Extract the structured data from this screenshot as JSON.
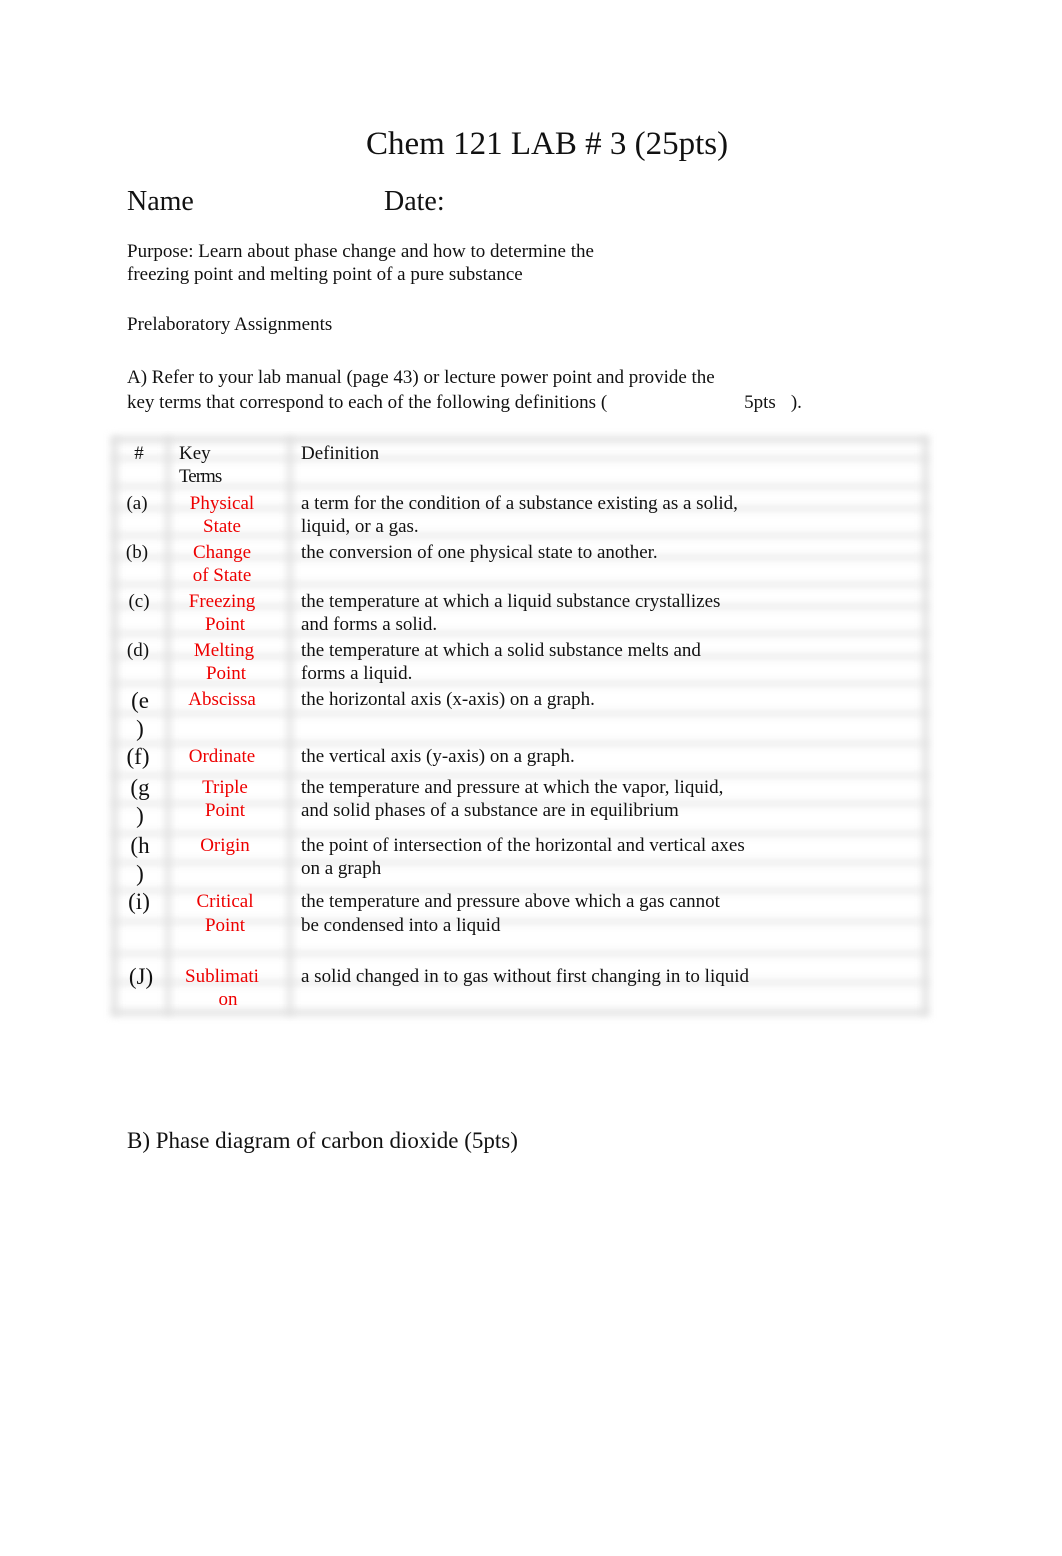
{
  "document": {
    "title": "Chem 121 LAB # 3 (25pts)",
    "name_label": "Name",
    "date_label": "Date:",
    "purpose_line1": "Purpose: Learn about phase change and how to determine the",
    "purpose_line2": "freezing point and melting point of a pure substance",
    "prelab_heading": "Prelaboratory Assignments",
    "instruction_line1": "A)  Refer to your lab manual (page 43) or lecture power point and provide the",
    "instruction_line2_start": "key terms that correspond to each of the following definitions (",
    "instruction_points": "5pts",
    "instruction_line2_end": ").",
    "section_b_heading": "B) Phase diagram of carbon dioxide (5pts)"
  },
  "table": {
    "headers": {
      "number": "#",
      "key_terms_line1": "Key",
      "key_terms_line2": "Terms",
      "definition": "Definition"
    },
    "term_color": "#ee0000",
    "rows": [
      {
        "num": "(a)",
        "term1": "Physical",
        "term2": "State",
        "def1": "a term for the condition of a substance existing as a solid,",
        "def2": "liquid, or a gas."
      },
      {
        "num": "(b)",
        "term1": "Change",
        "term2": "of State",
        "def1": "the conversion of one physical state to another.",
        "def2": ""
      },
      {
        "num": "(c)",
        "term1": "Freezing",
        "term2": "Point",
        "def1": "the temperature at which a liquid substance crystallizes",
        "def2": "and forms a solid."
      },
      {
        "num": "(d)",
        "term1": "Melting",
        "term2": "Point",
        "def1": "the temperature at which a solid substance melts and",
        "def2": "forms a liquid."
      },
      {
        "num1": "(e",
        "num2": ")",
        "term1": "Abscissa",
        "term2": "",
        "def1": "the horizontal axis (x-axis) on a graph.",
        "def2": ""
      },
      {
        "num": "(f)",
        "term1": "Ordinate",
        "term2": "",
        "def1": "the vertical axis (y-axis) on a graph.",
        "def2": ""
      },
      {
        "num1": "(g",
        "num2": ")",
        "term1": "Triple",
        "term2": "Point",
        "def1": "the temperature and pressure at which the vapor, liquid,",
        "def2": "and solid phases of a substance are in equilibrium"
      },
      {
        "num1": "(h",
        "num2": ")",
        "term1": "Origin",
        "term2": "",
        "def1": "the point of intersection of the horizontal and vertical axes",
        "def2": "on a graph"
      },
      {
        "num": "(i)",
        "term1": "Critical",
        "term2": "Point",
        "def1": "the temperature and pressure above which a gas cannot",
        "def2": "be condensed into a liquid"
      },
      {
        "num": "(J)",
        "term1": "Sublimati",
        "term2": "on",
        "def1": "a solid changed in to gas without first changing in to liquid",
        "def2": ""
      }
    ]
  }
}
